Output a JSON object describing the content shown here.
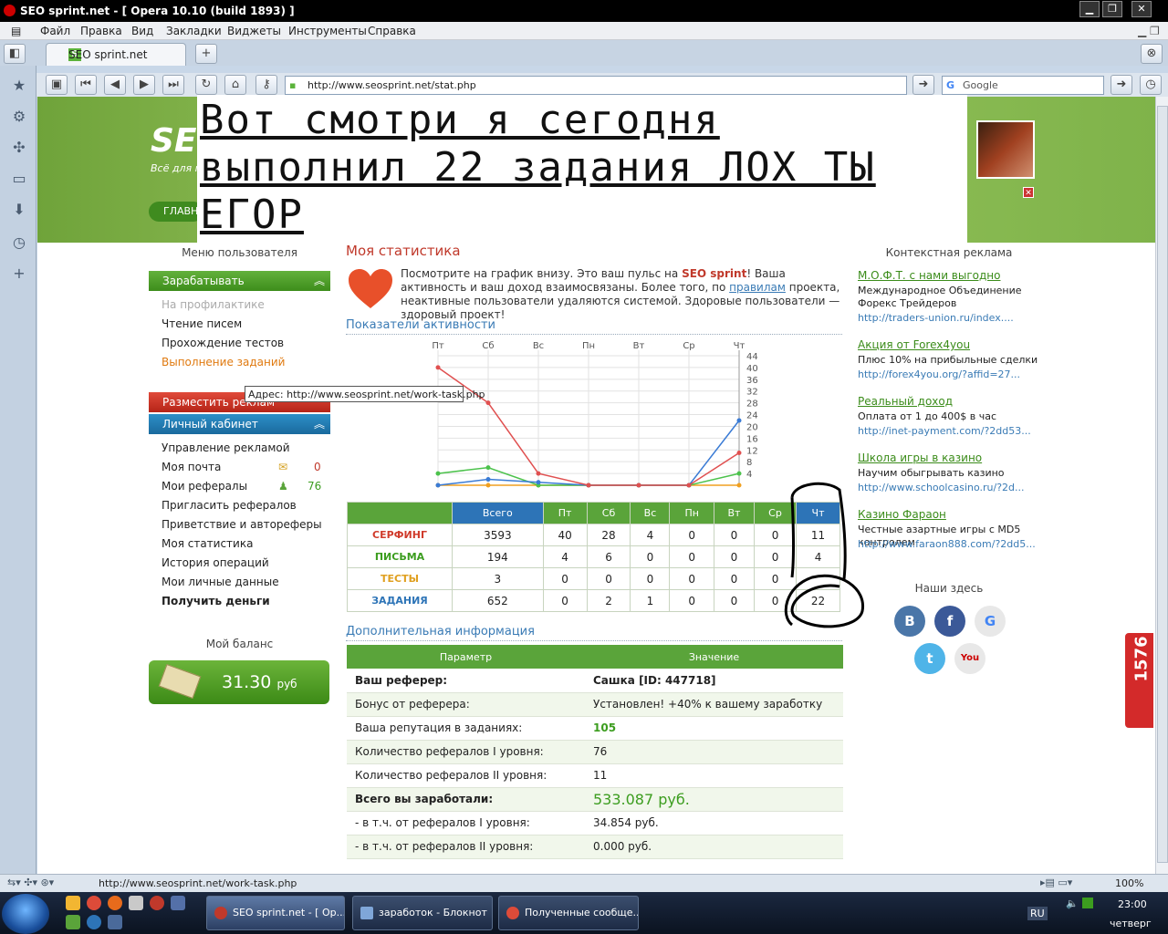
{
  "window": {
    "title": "SEO sprint.net - [ Opera 10.10 (build 1893) ]"
  },
  "menu": [
    "Файл",
    "Правка",
    "Вид",
    "Закладки",
    "Виджеты",
    "Инструменты",
    "Справка"
  ],
  "tab": {
    "label": "SEO sprint.net",
    "icon": "S"
  },
  "address": {
    "url": "http://www.seosprint.net/stat.php"
  },
  "search": {
    "engine": "Google"
  },
  "overlay_text": [
    "Вот смотри я сегодня",
    "выполнил 22 задания ЛОХ ТЫ",
    "ЕГОР"
  ],
  "header": {
    "logo": "SEO",
    "slogan": "Всё для п",
    "main_button": "ГЛАВН"
  },
  "left_menu": {
    "title": "Меню пользователя",
    "earn": {
      "label": "Зарабатывать",
      "items": [
        "На профилактике",
        "Чтение писем",
        "Прохождение тестов",
        "Выполнение заданий"
      ]
    },
    "advertise_label": "Разместить реклам",
    "cabinet": {
      "label": "Личный кабинет",
      "items": [
        "Управление рекламой",
        "Моя почта",
        "Мои рефералы",
        "Пригласить рефералов",
        "Приветствие и автореферы",
        "Моя статистика",
        "История операций",
        "Мои личные данные",
        "Получить деньги"
      ],
      "mail_count": "0",
      "referral_count": "76"
    },
    "balance_title": "Мой баланс",
    "balance_value": "31.30",
    "balance_unit": "руб"
  },
  "tooltip": "Адрес: http://www.seosprint.net/work-task.php",
  "stats": {
    "title": "Моя статистика",
    "intro_a": "Посмотрите на график внизу. Это ваш пульс на ",
    "intro_brand": "SEO sprint",
    "intro_b": "! Ваша активность и ваш доход взаимосвязаны. Более того, по ",
    "intro_link": "правилам",
    "intro_c": " проекта, неактивные пользователи удаляются системой. Здоровые пользователи — здоровый проект!",
    "activity_title": "Показатели активности",
    "extra_title": "Дополнительная информация"
  },
  "chart_data": {
    "type": "line",
    "categories": [
      "Пт",
      "Сб",
      "Вс",
      "Пн",
      "Вт",
      "Ср",
      "Чт"
    ],
    "ylim": [
      0,
      44
    ],
    "yticks": [
      4,
      8,
      12,
      16,
      20,
      24,
      28,
      32,
      36,
      40,
      44
    ],
    "series": [
      {
        "color": "#e05050",
        "values": [
          40,
          28,
          4,
          0,
          0,
          0,
          11
        ]
      },
      {
        "color": "#3a7bd5",
        "values": [
          0,
          2,
          1,
          0,
          0,
          0,
          22
        ]
      },
      {
        "color": "#4cc24c",
        "values": [
          4,
          6,
          0,
          0,
          0,
          0,
          4
        ]
      },
      {
        "color": "#f0a020",
        "values": [
          0,
          0,
          0,
          0,
          0,
          0,
          0
        ]
      }
    ]
  },
  "table": {
    "headers": [
      "Всего",
      "Пт",
      "Сб",
      "Вс",
      "Пн",
      "Вт",
      "Ср",
      "Чт"
    ],
    "rows": [
      {
        "label": "СЕРФИНГ",
        "color": "#d03b2b",
        "values": [
          "3593",
          "40",
          "28",
          "4",
          "0",
          "0",
          "0",
          "11"
        ]
      },
      {
        "label": "ПИСЬМА",
        "color": "#3c9d1f",
        "values": [
          "194",
          "4",
          "6",
          "0",
          "0",
          "0",
          "0",
          "4"
        ]
      },
      {
        "label": "ТЕСТЫ",
        "color": "#e0a020",
        "values": [
          "3",
          "0",
          "0",
          "0",
          "0",
          "0",
          "0",
          ""
        ]
      },
      {
        "label": "ЗАДАНИЯ",
        "color": "#2d74b7",
        "values": [
          "652",
          "0",
          "2",
          "1",
          "0",
          "0",
          "0",
          "22"
        ]
      }
    ]
  },
  "info": {
    "head_param": "Параметр",
    "head_value": "Значение",
    "rows": [
      {
        "p": "Ваш реферер:",
        "v": "Сашка [ID: 447718]"
      },
      {
        "p": "Бонус от реферера:",
        "v": "Установлен! +40% к вашему заработку"
      },
      {
        "p": "Ваша репутация в заданиях:",
        "v": "105"
      },
      {
        "p": "Количество рефералов I уровня:",
        "v": "76"
      },
      {
        "p": "Количество рефералов II уровня:",
        "v": "11"
      },
      {
        "p": "Всего вы заработали:",
        "v": "533.087 руб."
      },
      {
        "p": "- в т.ч. от рефералов I уровня:",
        "v": "34.854 руб."
      },
      {
        "p": "- в т.ч. от рефералов II уровня:",
        "v": "0.000 руб."
      }
    ]
  },
  "ads": {
    "title": "Контекстная реклама",
    "items": [
      {
        "h": "М.О.Ф.Т. с нами выгодно",
        "d": "Международное Объединение Форекс Трейдеров",
        "u": "http://traders-union.ru/index...."
      },
      {
        "h": "Акция от Forex4you",
        "d": "Плюс 10% на прибыльные сделки",
        "u": "http://forex4you.org/?affid=27..."
      },
      {
        "h": "Реальный доход",
        "d": "Оплата от 1 до 400$ в час",
        "u": "http://inet-payment.com/?2dd53..."
      },
      {
        "h": "Школа игры в казино",
        "d": "Научим обыгрывать казино",
        "u": "http://www.schoolcasino.ru/?2d..."
      },
      {
        "h": "Казино Фараон",
        "d": "Честные азартные игры с MD5 контролем",
        "u": "http://www.faraon888.com/?2dd5..."
      }
    ],
    "social_title": "Наши здесь",
    "counter": "1576"
  },
  "status": {
    "url": "http://www.seosprint.net/work-task.php",
    "zoom": "100%"
  },
  "taskbar": {
    "tasks": [
      "SEO sprint.net - [ Op...",
      "заработок - Блокнот",
      "Полученные сообще..."
    ],
    "lang": "RU",
    "time": "23:00",
    "day": "четверг"
  }
}
